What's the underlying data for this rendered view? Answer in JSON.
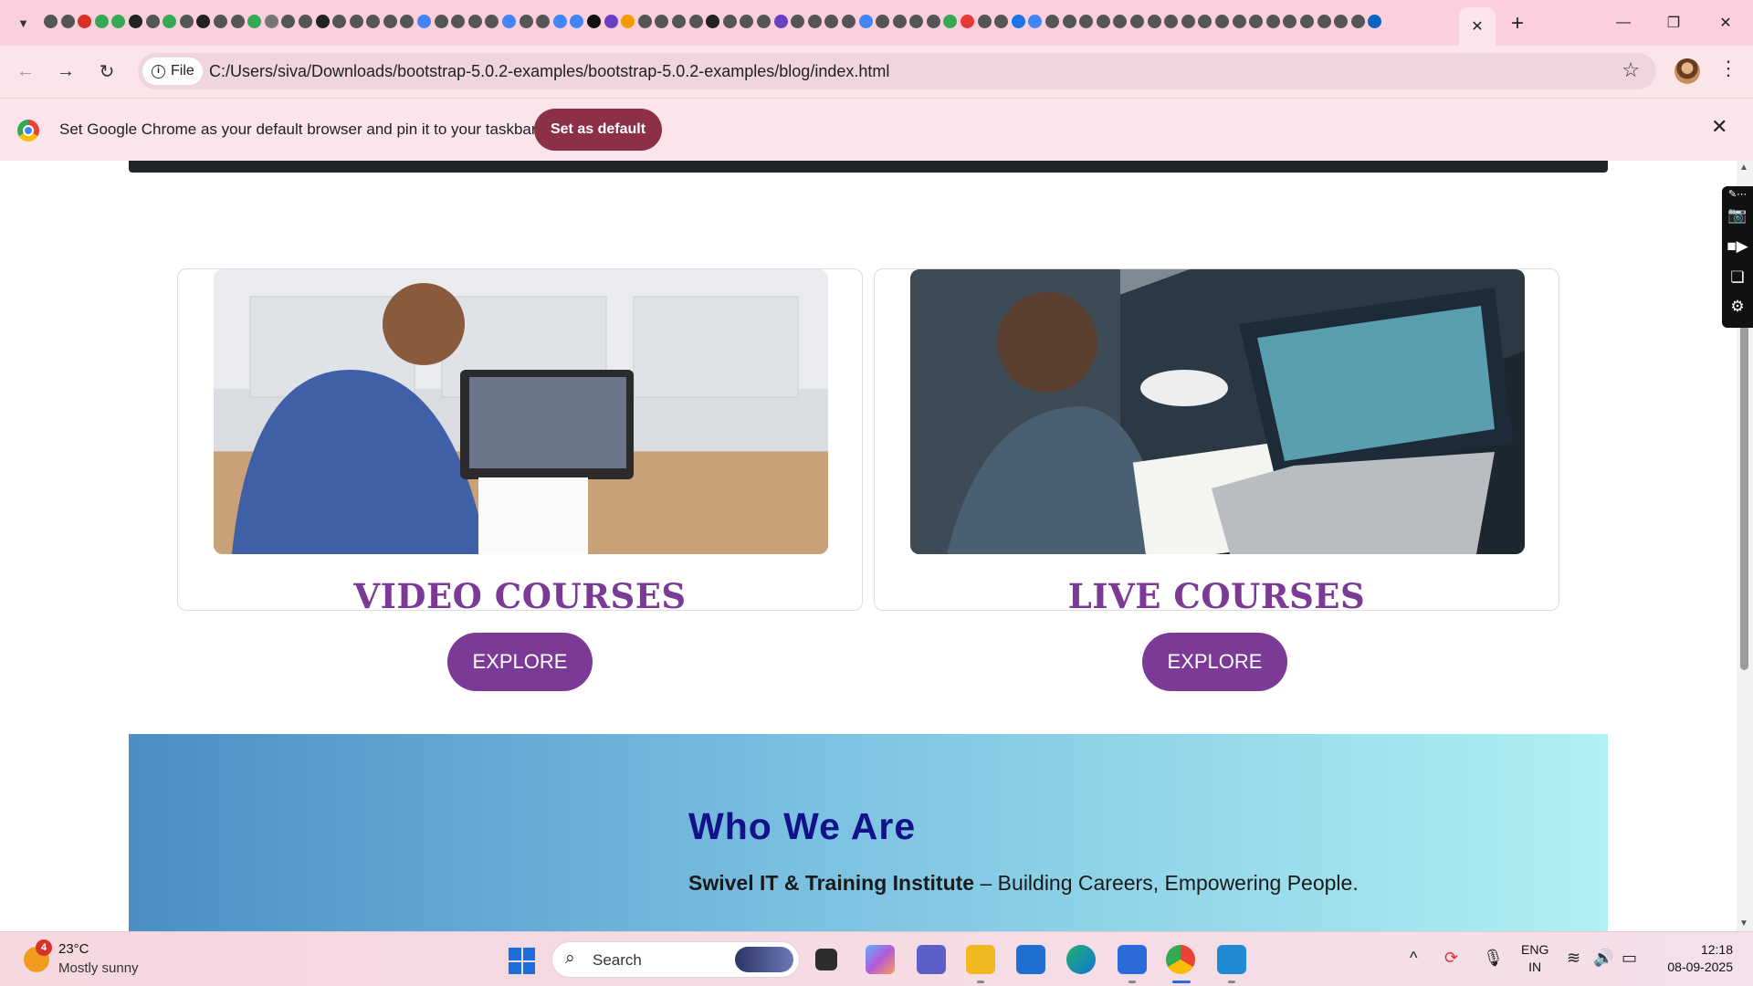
{
  "browser": {
    "tab_active_close": "✕",
    "new_tab": "+",
    "address": {
      "chip_label": "File",
      "url": "C:/Users/siva/Downloads/bootstrap-5.0.2-examples/bootstrap-5.0.2-examples/blog/index.html"
    },
    "infobar": {
      "message": "Set Google Chrome as your default browser and pin it to your taskbar",
      "button": "Set as default"
    },
    "window_controls": {
      "minimize": "—",
      "restore": "❐",
      "close": "✕"
    }
  },
  "page": {
    "cards": [
      {
        "title": "VIDEO COURSES",
        "button": "EXPLORE"
      },
      {
        "title": "LIVE COURSES",
        "button": "EXPLORE"
      }
    ],
    "who": {
      "title": "Who We Are",
      "subtitle_bold": "Swivel IT & Training Institute",
      "subtitle_rest": " – Building Careers, Empowering People."
    },
    "accent_color": "#7b3a96"
  },
  "taskbar": {
    "weather": {
      "temp": "23°C",
      "condition": "Mostly sunny",
      "badge": "4"
    },
    "search_placeholder": "Search",
    "language": {
      "line1": "ENG",
      "line2": "IN"
    },
    "clock": {
      "time": "12:18",
      "date": "08-09-2025"
    }
  }
}
